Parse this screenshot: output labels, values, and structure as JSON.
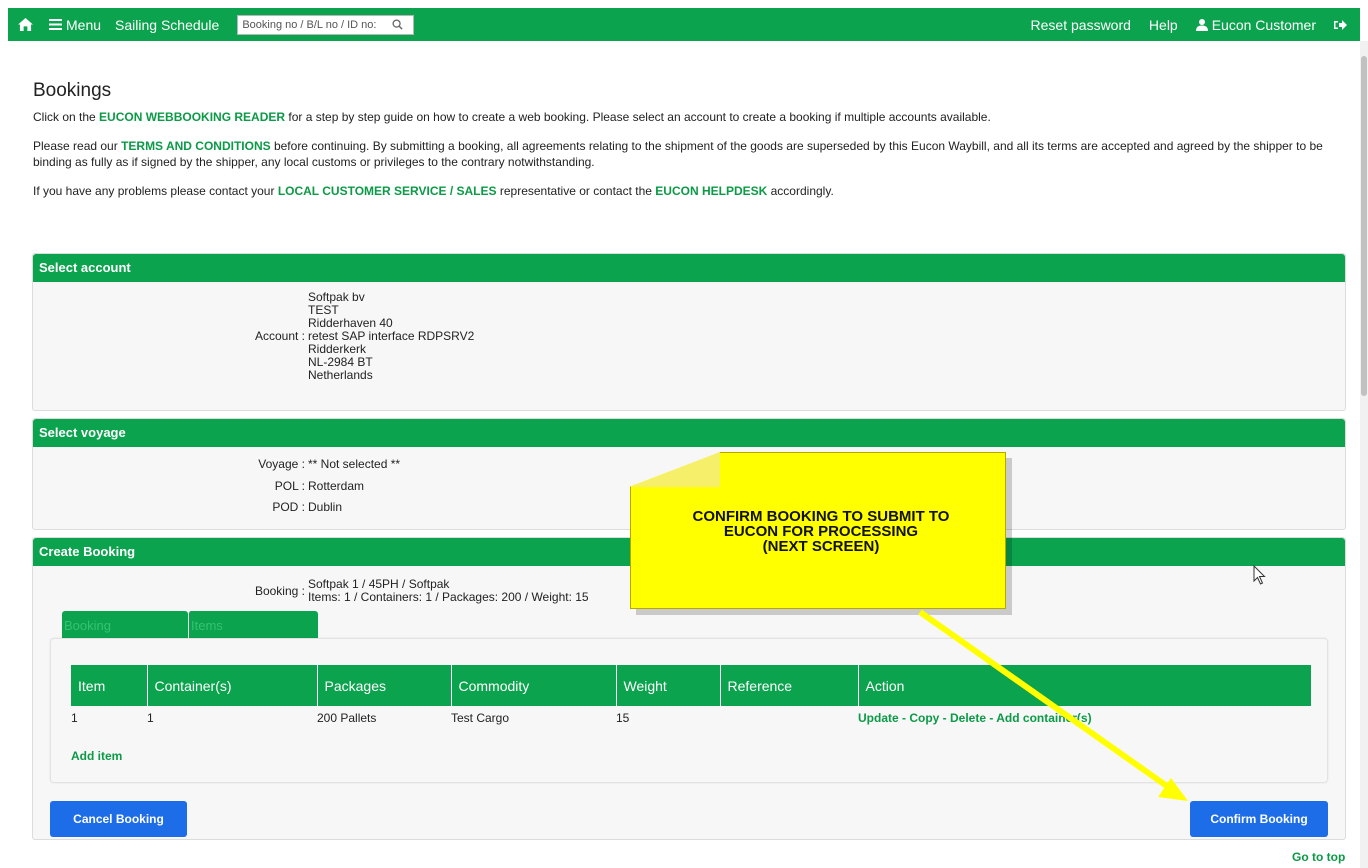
{
  "nav": {
    "menu_label": "Menu",
    "sailing_label": "Sailing Schedule",
    "search_placeholder": "Booking no / B/L no / ID no:",
    "reset_password": "Reset password",
    "help": "Help",
    "user": "Eucon Customer"
  },
  "page": {
    "title": "Bookings",
    "p1_pre": "Click on the ",
    "p1_link": "EUCON WEBBOOKING READER",
    "p1_post": " for a step by step guide on how to create a web booking. Please select an account to create a booking if multiple accounts available.",
    "p2_pre": "Please read our ",
    "p2_link": "TERMS AND CONDITIONS",
    "p2_post": " before continuing. By submitting a booking, all agreements relating to the shipment of the goods are superseded by this Eucon Waybill, and all its terms are accepted and agreed by the shipper to be binding as fully as if signed by the shipper, any local customs or privileges to the contrary notwithstanding.",
    "p3_pre": "If you have any problems please contact your ",
    "p3_link1": "LOCAL CUSTOMER SERVICE / SALES",
    "p3_mid": " representative or contact the ",
    "p3_link2": "EUCON HELPDESK",
    "p3_post": " accordingly."
  },
  "account": {
    "header": "Select account",
    "label": "Account :",
    "lines": [
      "Softpak bv",
      "TEST",
      "Ridderhaven 40",
      "retest SAP interface RDPSRV2",
      "Ridderkerk",
      "NL-2984 BT",
      "Netherlands"
    ]
  },
  "voyage": {
    "header": "Select voyage",
    "voyage_label": "Voyage :",
    "voyage_value": "** Not selected **",
    "pol_label": "POL :",
    "pol_value": "Rotterdam",
    "pod_label": "POD :",
    "pod_value": "Dublin"
  },
  "booking": {
    "header": "Create Booking",
    "label": "Booking :",
    "line1": "Softpak 1 / 45PH / Softpak",
    "line2": "Items: 1 / Containers: 1 / Packages: 200 / Weight: 15",
    "tabs": [
      "Booking",
      "Items"
    ],
    "columns": [
      "Item",
      "Container(s)",
      "Packages",
      "Commodity",
      "Weight",
      "Reference",
      "Action"
    ],
    "rows": [
      {
        "item": "1",
        "containers": "1",
        "packages": "200 Pallets",
        "commodity": "Test Cargo",
        "weight": "15",
        "reference": "",
        "action": "Update - Copy - Delete - Add container(s)"
      }
    ],
    "add_item": "Add item",
    "cancel": "Cancel Booking",
    "confirm": "Confirm Booking"
  },
  "go_to_top": "Go to top",
  "annotation": {
    "line1": "CONFIRM BOOKING TO SUBMIT TO",
    "line2": "EUCON FOR PROCESSING",
    "line3": "(NEXT SCREEN)"
  },
  "colors": {
    "brand_green": "#0ba34d",
    "button_blue": "#1d6ce8",
    "callout_yellow": "#ffff00"
  }
}
